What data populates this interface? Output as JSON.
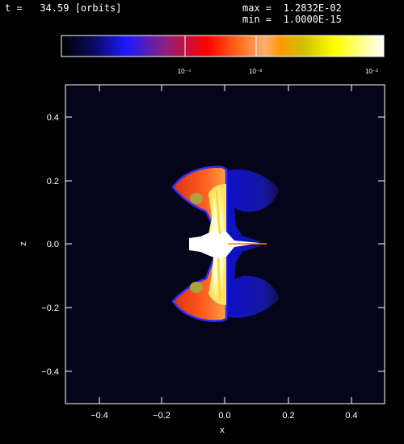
{
  "header": {
    "time_label": "t =   34.59 [orbits]",
    "max_label": "max =  1.2832E-02",
    "min_label": "min =  1.0000E-15"
  },
  "colorbar": {
    "ticks": [
      "10⁻⁴",
      "10⁻³",
      "10⁻²"
    ],
    "gradient_colors": [
      "#000000",
      "#0a0a50",
      "#1a1aff",
      "#8a2080",
      "#ff0000",
      "#ff6a1a",
      "#ffb070",
      "#ff9900",
      "#d0c000",
      "#ffff00",
      "#ffffff"
    ]
  },
  "plot": {
    "x_axis_label": "x",
    "y_axis_label": "z",
    "x_ticks": [
      "−0.4",
      "−0.2",
      "0.0",
      "0.2",
      "0.4"
    ],
    "y_ticks": [
      "0.4",
      "0.2",
      "0.0",
      "−0.2",
      "−0.4"
    ],
    "background_color": "#05051a"
  }
}
